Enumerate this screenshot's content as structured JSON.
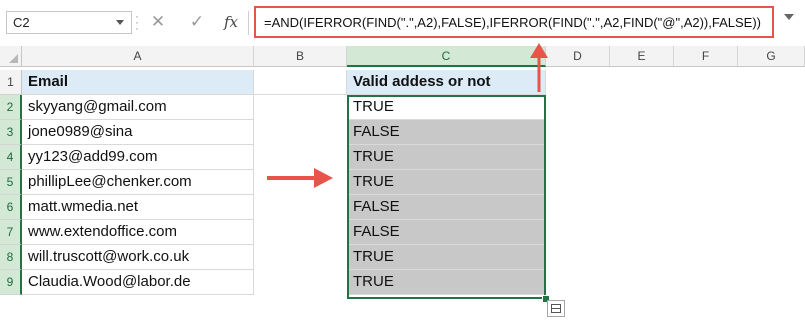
{
  "name_box": {
    "value": "C2"
  },
  "formula_bar": {
    "cancel_glyph": "✕",
    "enter_glyph": "✓",
    "fx_label": "fx",
    "formula": "=AND(IFERROR(FIND(\".\",A2),FALSE),IFERROR(FIND(\".\",A2,FIND(\"@\",A2)),FALSE))"
  },
  "columns": [
    "A",
    "B",
    "C",
    "D",
    "E",
    "F",
    "G"
  ],
  "rows": [
    "1",
    "2",
    "3",
    "4",
    "5",
    "6",
    "7",
    "8",
    "9"
  ],
  "headers": {
    "email": "Email",
    "valid": "Valid addess or not"
  },
  "emails": [
    "skyyang@gmail.com",
    "jone0989@sina",
    "yy123@add99.com",
    "phillipLee@chenker.com",
    "matt.wmedia.net",
    "www.extendoffice.com",
    "will.truscott@work.co.uk",
    "Claudia.Wood@labor.de"
  ],
  "results": [
    "TRUE",
    "FALSE",
    "TRUE",
    "TRUE",
    "FALSE",
    "FALSE",
    "TRUE",
    "TRUE"
  ],
  "colors": {
    "annotation_red": "#e8534a",
    "selection_green": "#217346",
    "header_fill": "#ddebf7",
    "result_fill": "#c8c8c8"
  }
}
